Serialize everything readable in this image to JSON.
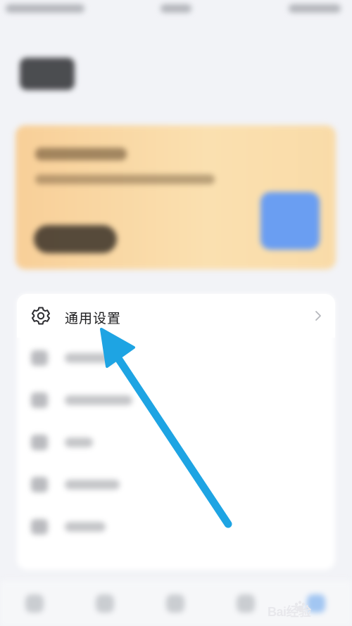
{
  "settings": {
    "general_settings_label": "通用设置",
    "icon": "gear-icon",
    "chevron": "chevron-right-icon"
  },
  "annotation": {
    "arrow_color": "#1ea4e3"
  },
  "watermark": {
    "text": "Bai经验",
    "icon": "paw-icon"
  }
}
